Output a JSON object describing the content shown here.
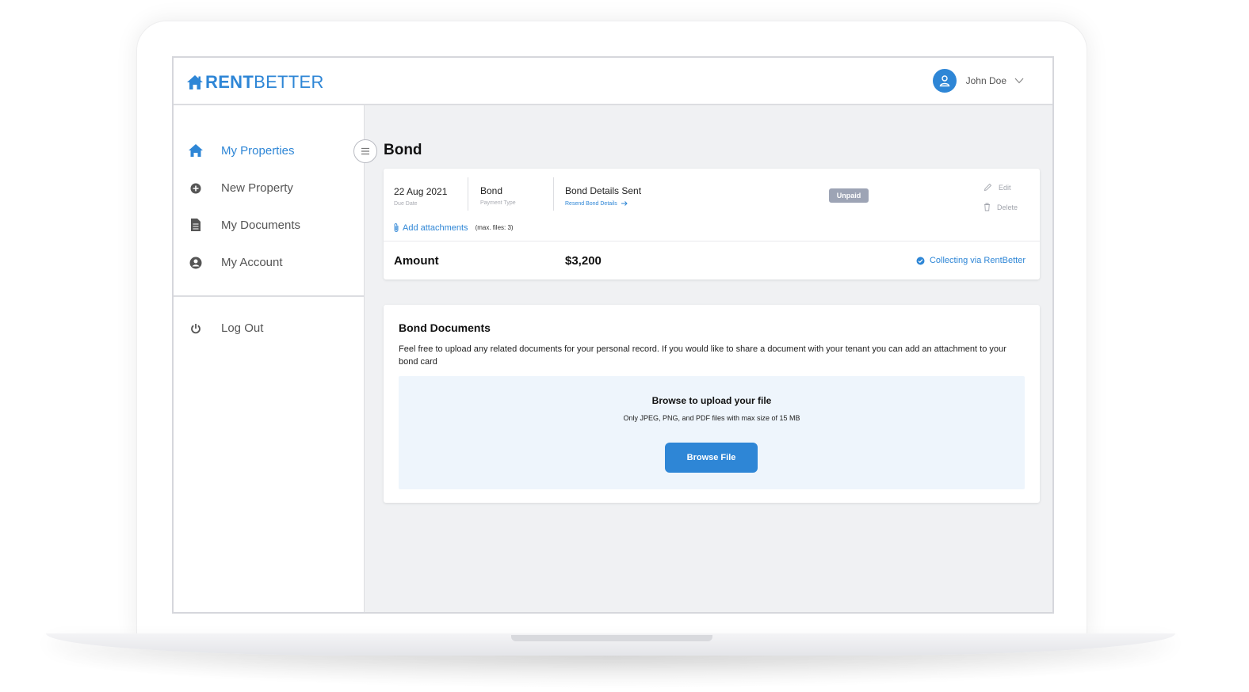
{
  "header": {
    "logo_bold": "RENT",
    "logo_light": "BETTER",
    "user_name": "John Doe"
  },
  "sidebar": {
    "items": [
      {
        "label": "My Properties",
        "icon": "home-icon",
        "active": true
      },
      {
        "label": "New Property",
        "icon": "plus-circle-icon",
        "active": false
      },
      {
        "label": "My Documents",
        "icon": "document-icon",
        "active": false
      },
      {
        "label": "My Account",
        "icon": "user-circle-icon",
        "active": false
      }
    ],
    "logout_label": "Log Out"
  },
  "main": {
    "title": "Bond",
    "bond_card": {
      "due_date": "22 Aug 2021",
      "due_date_label": "Due Date",
      "payment_type": "Bond",
      "payment_type_label": "Payment Type",
      "status_text": "Bond Details Sent",
      "resend_link": "Resend Bond Details",
      "badge": "Unpaid",
      "edit_label": "Edit",
      "delete_label": "Delete",
      "add_attachments": "Add attachments",
      "max_files": "(max. files: 3)",
      "amount_label": "Amount",
      "amount_value": "$3,200",
      "collecting": "Collecting via RentBetter"
    },
    "documents": {
      "title": "Bond Documents",
      "description": "Feel free to upload any related documents for your personal record. If you would like to share a document with your tenant you can add an attachment to your bond card",
      "upload_title": "Browse to upload your file",
      "upload_hint": "Only JPEG, PNG, and PDF files with max size of 15 MB",
      "browse_button": "Browse File"
    }
  },
  "colors": {
    "accent": "#2e86d6",
    "badge_unpaid": "#9da4b5",
    "dropzone_bg": "#eef5fc"
  }
}
